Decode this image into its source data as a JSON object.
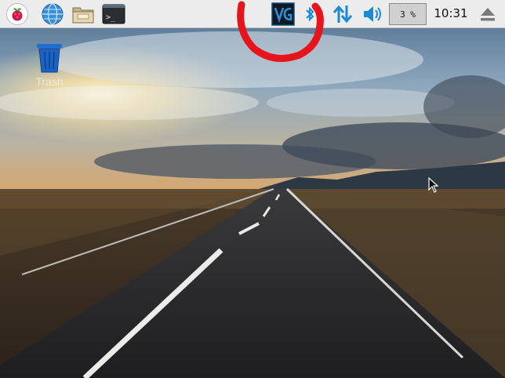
{
  "taskbar": {
    "launchers": [
      {
        "icon": "raspberry-menu-icon"
      },
      {
        "icon": "web-browser-icon"
      },
      {
        "icon": "file-manager-icon"
      },
      {
        "icon": "terminal-icon"
      }
    ],
    "tray": {
      "vnc_icon": "vnc-server-icon",
      "bluetooth_icon": "bluetooth-icon",
      "network_icon": "network-updown-icon",
      "volume_icon": "volume-icon",
      "cpu_usage": "3 %",
      "clock": "10:31",
      "eject_icon": "eject-icon"
    },
    "terminal_prompt": ">_"
  },
  "desktop": {
    "icons": [
      {
        "label": "Trash",
        "icon": "trash-icon"
      }
    ]
  },
  "colors": {
    "taskbar_bg": "#ececec",
    "accent_blue": "#1a8ad4",
    "annotation_red": "#e8141c"
  }
}
